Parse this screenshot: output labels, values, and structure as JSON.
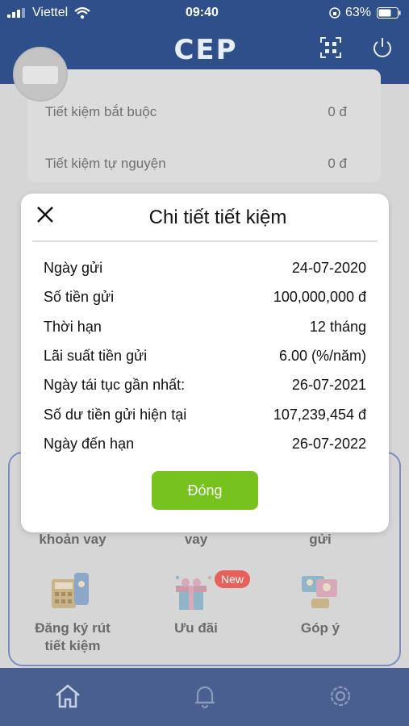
{
  "status_bar": {
    "carrier": "Viettel",
    "time": "09:40",
    "battery": "63%"
  },
  "header": {
    "logo": "CEP"
  },
  "savings": [
    {
      "label": "Tiết kiệm bắt buộc",
      "value": "0 đ"
    },
    {
      "label": "Tiết kiệm tự nguyện",
      "value": "0 đ"
    }
  ],
  "menu": {
    "row1": [
      "khoản vay",
      "vay",
      "gửi"
    ],
    "row2": [
      {
        "label_line1": "Đăng ký rút",
        "label_line2": "tiết kiệm",
        "icon": "calculator-icon"
      },
      {
        "label_line1": "Ưu đãi",
        "label_line2": "",
        "icon": "gift-icon"
      },
      {
        "label_line1": "Góp ý",
        "label_line2": "",
        "icon": "feedback-icon"
      }
    ],
    "new_badge": "New"
  },
  "modal": {
    "title": "Chi tiết tiết kiệm",
    "rows": [
      {
        "label": "Ngày gửi",
        "value": "24-07-2020"
      },
      {
        "label": "Số tiền gửi",
        "value": "100,000,000 đ"
      },
      {
        "label": "Thời hạn",
        "value": "12 tháng"
      },
      {
        "label": "Lãi suất tiền gửi",
        "value": "6.00 (%/năm)"
      },
      {
        "label": "Ngày tái tục gần nhất:",
        "value": "26-07-2021"
      },
      {
        "label": "Số dư tiền gửi hiện tại",
        "value": "107,239,454 đ"
      },
      {
        "label": "Ngày đến hạn",
        "value": "26-07-2022"
      }
    ],
    "close_label": "Đóng"
  },
  "bottom_nav": {
    "icons": [
      "home-icon",
      "bell-icon",
      "gear-icon"
    ]
  },
  "colors": {
    "header": "#2e4f8a",
    "accent_green": "#78c21f",
    "nav": "#495f8f",
    "badge": "#e8605a"
  }
}
